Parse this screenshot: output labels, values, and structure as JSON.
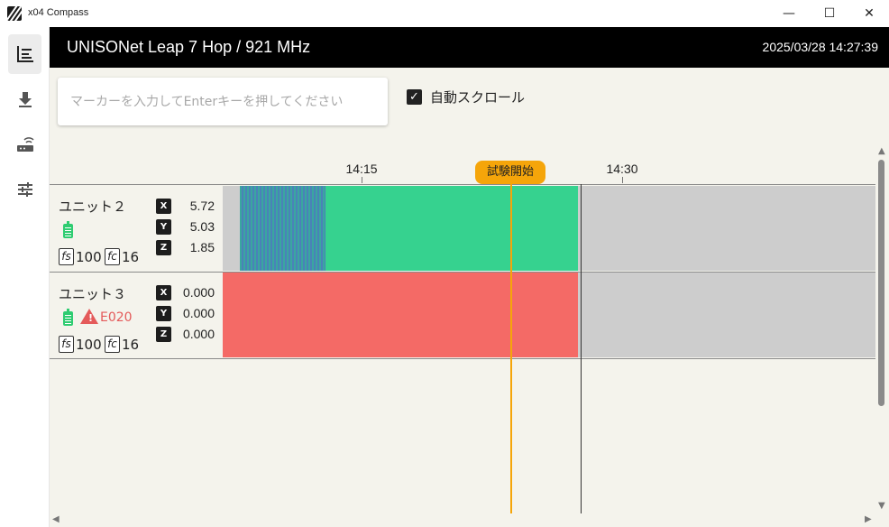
{
  "window": {
    "title": "x04 Compass",
    "minimize": "—",
    "maximize": "☐",
    "close": "✕"
  },
  "sidebar": {
    "items": [
      {
        "icon": "timeline-icon",
        "active": true
      },
      {
        "icon": "download-icon",
        "active": false
      },
      {
        "icon": "router-icon",
        "active": false
      },
      {
        "icon": "tune-icon",
        "active": false
      }
    ]
  },
  "header": {
    "title": "UNISONet Leap 7 Hop / 921 MHz",
    "datetime": "2025/03/28 14:27:39"
  },
  "toolbar": {
    "marker_placeholder": "マーカーを入力してEnterキーを押してください",
    "autoscroll_label": "自動スクロール",
    "autoscroll_checked": true
  },
  "timeline": {
    "ticks": [
      "14:15",
      "14:30"
    ],
    "event_label": "試験開始"
  },
  "units": [
    {
      "name": "ユニット２",
      "fs_label": "fs",
      "fs": "100",
      "fc_label": "fc",
      "fc": "16",
      "x_label": "X",
      "x": "5.72",
      "y_label": "Y",
      "y": "5.03",
      "z_label": "Z",
      "z": "1.85",
      "error": ""
    },
    {
      "name": "ユニット３",
      "fs_label": "fs",
      "fs": "100",
      "fc_label": "fc",
      "fc": "16",
      "x_label": "X",
      "x": "0.000",
      "y_label": "Y",
      "y": "0.000",
      "z_label": "Z",
      "z": "0.000",
      "error": "E020"
    }
  ],
  "colors": {
    "accent": "#f5a50a",
    "ok": "#36d28f",
    "error": "#f46a66",
    "idle": "#cdcdcd"
  }
}
